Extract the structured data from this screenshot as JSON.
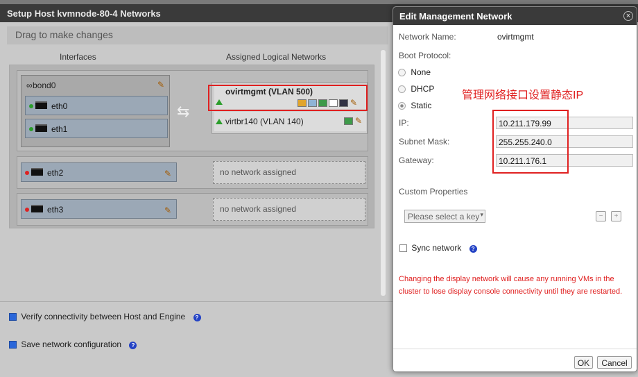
{
  "bg_tab_text": "...",
  "setup_dialog": {
    "title": "Setup Host kvmnode-80-4 Networks",
    "subtitle": "Drag to make changes",
    "col_interfaces": "Interfaces",
    "col_assigned": "Assigned Logical Networks",
    "bond": {
      "name": "bond0",
      "slaves": [
        "eth0",
        "eth1"
      ],
      "networks": [
        {
          "name": "ovirtmgmt (VLAN 500)"
        },
        {
          "name": "virtbr140 (VLAN 140)"
        }
      ]
    },
    "rows": [
      {
        "nic": "eth2",
        "network": "no network assigned"
      },
      {
        "nic": "eth3",
        "network": "no network assigned"
      }
    ],
    "verify_label": "Verify connectivity between Host and Engine",
    "save_label": "Save network configuration",
    "verify_checked": true,
    "save_checked": true
  },
  "edit_dialog": {
    "title": "Edit Management Network",
    "close_glyph": "×",
    "network_name_label": "Network Name:",
    "network_name": "ovirtmgmt",
    "boot_protocol_label": "Boot Protocol:",
    "boot_options": [
      "None",
      "DHCP",
      "Static"
    ],
    "boot_selected": "Static",
    "annotation": "管理网络接口设置静态IP",
    "ip_label": "IP:",
    "ip": "10.211.179.99",
    "mask_label": "Subnet Mask:",
    "mask": "255.255.240.0",
    "gateway_label": "Gateway:",
    "gateway": "10.211.176.1",
    "custom_props_label": "Custom Properties",
    "select_key_placeholder": "Please select a key",
    "minus": "−",
    "plus": "+",
    "sync_label": "Sync network",
    "warning": "Changing the display network will cause any running VMs in the cluster to lose display console connectivity until they are restarted.",
    "ok": "OK",
    "cancel": "Cancel"
  },
  "colors": {
    "annotation_red": "#e02020",
    "link_green": "#2c9e2c",
    "help_blue": "#2342c5"
  }
}
